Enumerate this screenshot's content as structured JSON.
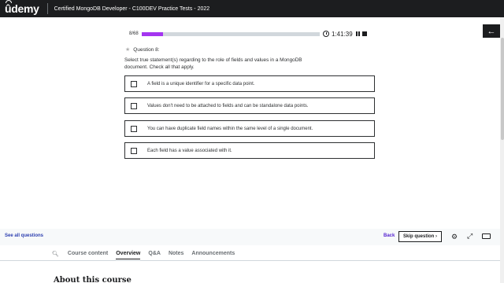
{
  "header": {
    "logo": "ûdemy",
    "course_title": "Certified MongoDB Developer - C100DEV Practice Tests - 2022"
  },
  "progress": {
    "count_text": "8/68",
    "fraction": 0.1176,
    "timer": "1:41:39"
  },
  "question": {
    "label": "Question 8:",
    "text": "Select true statement(s) regarding to the role of fields and values in a MongoDB document. Check all that apply.",
    "options": [
      "A field is a unique identifier for a specific data point.",
      "Values don't need to be attached to fields and can be standalone data points.",
      "You can have duplicate field names within the same level of a single document.",
      "Each field has a value associated with it."
    ]
  },
  "footer": {
    "see_all": "See all questions",
    "back": "Back",
    "skip": "Skip question",
    "skip_chevron": "›"
  },
  "tabs": {
    "items": [
      "Course content",
      "Overview",
      "Q&A",
      "Notes",
      "Announcements"
    ],
    "active": "Overview"
  },
  "about_heading": "About this course",
  "icons": {
    "sidebar_toggle": "arrow-left-icon",
    "timer": "clock-icon",
    "pause": "pause-icon",
    "stop": "stop-icon",
    "settings": "gear-icon",
    "expand": "expand-icon",
    "keyboard": "keyboard-icon",
    "search": "search-icon"
  },
  "colors": {
    "accent": "#a435f0",
    "link": "#5624d0",
    "header_bg": "#1c1d1f"
  }
}
